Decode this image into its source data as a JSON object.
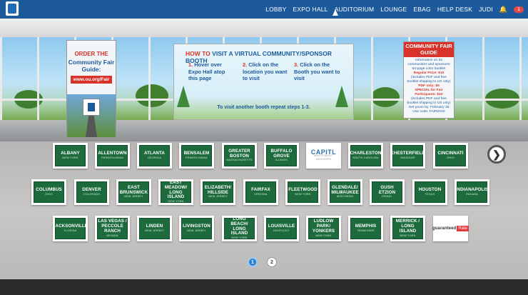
{
  "nav": {
    "items": [
      "LOBBY",
      "EXPO HALL",
      "AUDITORIUM",
      "LOUNGE",
      "EBAG",
      "HELP DESK",
      "JUDI"
    ],
    "notification_count": "1"
  },
  "poster_left": {
    "line1": "ORDER THE",
    "line2": "Community Fair Guide:",
    "url": "www.ou.org/Fair"
  },
  "banner": {
    "title_how": "HOW TO",
    "title_rest": "VISIT A VIRTUAL COMMUNITY/SPONSOR BOOTH",
    "step1_num": "1.",
    "step1": "Hover over Expo Hall atop this page",
    "step2_num": "2.",
    "step2": "Click on the location you want to visit",
    "step3_num": "3.",
    "step3": "Click on the Booth you want to visit",
    "footer": "To visit another booth repeat steps 1-3."
  },
  "poster_right": {
    "head": "COMMUNITY FAIR GUIDE",
    "info": "Information on 52 communities and sponsors!",
    "booklet": "64-page color booklet",
    "regular": "Regular Price: $10",
    "shipping": "(includes PDF and free booklet shipping to US only)",
    "pdf": "PDF only: $5",
    "special": "SPECIAL for Fair Participants: $10",
    "special_note": "(includes PDF and free booklet shipping to US only)",
    "offer": "Get yours by: February 28",
    "code": "Use code: FAIR2020"
  },
  "booths": {
    "row1": [
      {
        "name": "ALBANY",
        "sub": "NEW YORK"
      },
      {
        "name": "ALLENTOWN",
        "sub": "PENNSYLVANIA"
      },
      {
        "name": "ATLANTA",
        "sub": "GEORGIA"
      },
      {
        "name": "BENSALEM",
        "sub": "PENNSYLVANIA"
      },
      {
        "name": "GREATER BOSTON",
        "sub": "MASSACHUSETTS"
      },
      {
        "name": "BUFFALO GROVE",
        "sub": "ILLINOIS"
      },
      {
        "name": "CAPITL",
        "sub": "MULTIFAMILY ADVISORS"
      },
      {
        "name": "CHARLESTON",
        "sub": "SOUTH CAROLINA"
      },
      {
        "name": "CHESTERFIELD",
        "sub": "MISSOURI"
      },
      {
        "name": "CINCINNATI",
        "sub": "OHIO"
      }
    ],
    "row2": [
      {
        "name": "COLUMBUS",
        "sub": "OHIO"
      },
      {
        "name": "DENVER",
        "sub": "COLORADO"
      },
      {
        "name": "EAST BRUNSWICK",
        "sub": "NEW JERSEY"
      },
      {
        "name": "EAST MEADOW/ LONG ISLAND",
        "sub": "NEW YORK"
      },
      {
        "name": "ELIZABETH/ HILLSIDE",
        "sub": "NEW JERSEY"
      },
      {
        "name": "FAIRFAX",
        "sub": "VIRGINIA"
      },
      {
        "name": "FLEETWOOD",
        "sub": "NEW YORK"
      },
      {
        "name": "GLENDALE/ MILWAUKEE",
        "sub": "WISCONSIN"
      },
      {
        "name": "GUSH ETZION",
        "sub": "ISRAEL"
      },
      {
        "name": "HOUSTON",
        "sub": "TEXAS"
      },
      {
        "name": "INDIANAPOLIS",
        "sub": "INDIANA"
      }
    ],
    "row3": [
      {
        "name": "JACKSONVILLE",
        "sub": "FLORIDA"
      },
      {
        "name": "LAS VEGAS / PECCOLE RANCH",
        "sub": "NEVADA"
      },
      {
        "name": "LINDEN",
        "sub": "NEW JERSEY"
      },
      {
        "name": "LIVINGSTON",
        "sub": "NEW JERSEY"
      },
      {
        "name": "LONG BEACH/ LONG ISLAND",
        "sub": "NEW YORK"
      },
      {
        "name": "LOUISVILLE",
        "sub": "KENTUCKY"
      },
      {
        "name": "LUDLOW PARK/ YONKERS",
        "sub": "NEW YORK"
      },
      {
        "name": "MEMPHIS",
        "sub": "TENNESSEE"
      },
      {
        "name": "MERRICK / LONG ISLAND",
        "sub": "NEW YORK"
      },
      {
        "name": "guaranteed",
        "badge": "Rate",
        "sub": "AFFINITY"
      }
    ]
  },
  "pagination": {
    "page1": "1",
    "page2": "2"
  },
  "next_arrow": "❯"
}
